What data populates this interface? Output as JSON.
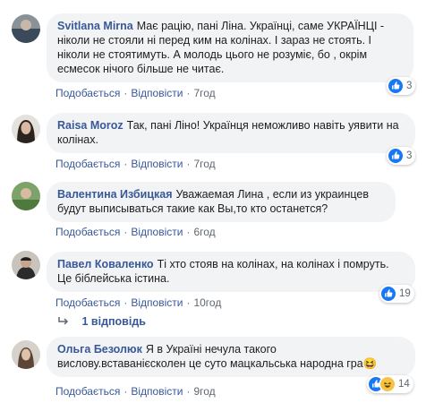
{
  "comments": [
    {
      "author": "Svitlana Mirna",
      "text": "Має рацію, пані Ліна. Українці, саме УКРАЇНЦІ - ніколи не стояли ні перед ким на колінах. І зараз не стоять. І ніколи не стоятимуть. А молодь цього не розуміє, бо , окрім есмесок нічого більше не читає.",
      "like": "Подобається",
      "reply": "Відповісти",
      "time": "7год",
      "reactions": "3"
    },
    {
      "author": "Raisa Moroz",
      "text": "Так, пані Ліно! Українця неможливо навіть уявити на колінах.",
      "like": "Подобається",
      "reply": "Відповісти",
      "time": "7год",
      "reactions": "3"
    },
    {
      "author": "Валентина Избицкая",
      "text": "Уважаемая Лина , если из украинцев будут выписываться такие как Вы,то кто останется?",
      "like": "Подобається",
      "reply": "Відповісти",
      "time": "6год",
      "reactions": ""
    },
    {
      "author": "Павел Коваленко",
      "text": "Ті хто стояв на колінах, на колінах і помруть. Це біблейська істина.",
      "like": "Подобається",
      "reply": "Відповісти",
      "time": "10год",
      "reactions": "19"
    },
    {
      "author": "Ольга Безолюк",
      "text": "Я в Україні нечула такого вислову.вставанієсколен це суто мацкальська народна гра😆",
      "like": "Подобається",
      "reply": "Відповісти",
      "time": "9год",
      "reactions": "14"
    }
  ],
  "replies_link": "1 відповідь",
  "icons": {
    "like": "thumbs-up-icon",
    "haha": "laughing-face-icon",
    "reply_arrow": "reply-arrow-icon"
  },
  "colors": {
    "author": "#385898",
    "like": "#1877f2",
    "bubble": "#f2f3f5"
  }
}
